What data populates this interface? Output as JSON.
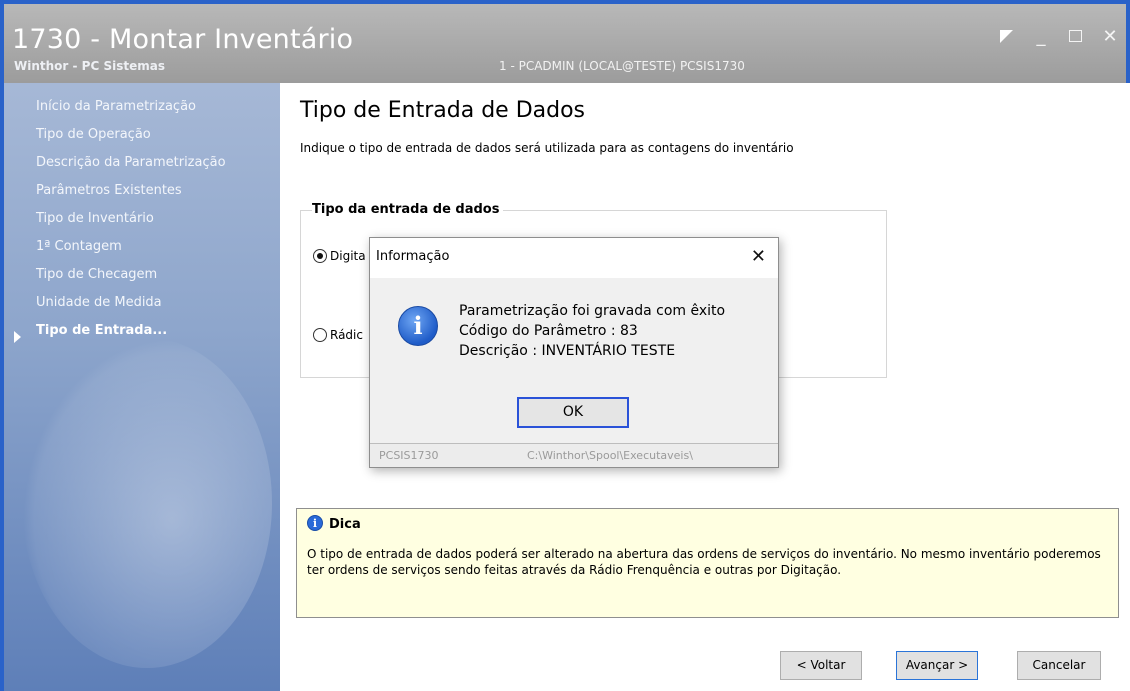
{
  "window": {
    "title": "1730 - Montar Inventário",
    "subtitle": "Winthor - PC Sistemas",
    "user_info": "1 - PCADMIN (LOCAL@TESTE)   PCSIS1730"
  },
  "sidebar": {
    "items": [
      {
        "label": "Início da Parametrização"
      },
      {
        "label": "Tipo de Operação"
      },
      {
        "label": "Descrição da Parametrização"
      },
      {
        "label": "Parâmetros Existentes"
      },
      {
        "label": "Tipo de Inventário"
      },
      {
        "label": "1ª Contagem"
      },
      {
        "label": "Tipo de Checagem"
      },
      {
        "label": "Unidade de Medida"
      },
      {
        "label": "Tipo de Entrada...",
        "active": true
      }
    ]
  },
  "main": {
    "title": "Tipo de Entrada de Dados",
    "description": "Indique o tipo de entrada de dados será utilizada para as contagens do inventário",
    "group_title": "Tipo da entrada de dados",
    "radio_digitacao": "Digita",
    "radio_radio": "Rádic"
  },
  "dica": {
    "title": "Dica",
    "text": "O tipo de entrada de dados poderá ser alterado na abertura das ordens de serviços do inventário.  No mesmo inventário poderemos ter ordens de serviços sendo feitas através da Rádio Frenquência e outras por Digitação."
  },
  "buttons": {
    "voltar": "< Voltar",
    "avancar": "Avançar >",
    "cancelar": "Cancelar"
  },
  "dialog": {
    "title": "Informação",
    "line1": "Parametrização foi gravada com êxito",
    "line2": "Código do Parâmetro : 83",
    "line3": "Descrição : INVENTÁRIO TESTE",
    "ok": "OK",
    "status_left": "PCSIS1730",
    "status_right": "C:\\Winthor\\Spool\\Executaveis\\"
  }
}
